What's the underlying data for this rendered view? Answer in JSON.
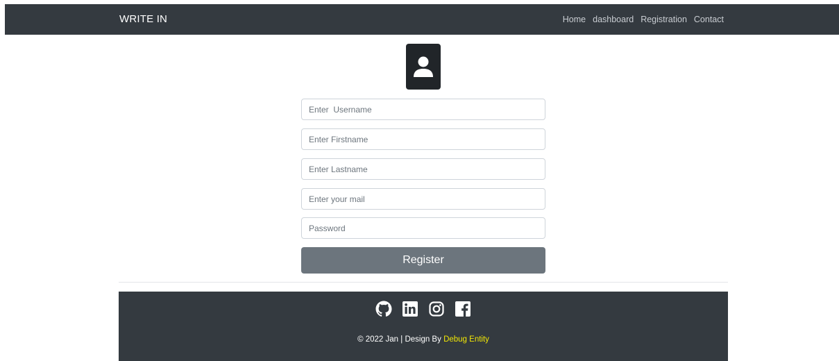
{
  "navbar": {
    "brand": "WRITE IN",
    "links": [
      "Home",
      "dashboard",
      "Registration",
      "Contact"
    ]
  },
  "form": {
    "username_placeholder": "Enter  Username",
    "firstname_placeholder": "Enter Firstname",
    "lastname_placeholder": "Enter Lastname",
    "email_placeholder": "Enter your mail",
    "password_placeholder": "Password",
    "register_label": "Register"
  },
  "footer": {
    "social_icons": [
      "github-icon",
      "linkedin-icon",
      "instagram-icon",
      "facebook-icon"
    ],
    "copyright_prefix": "© 2022 Jan | Design By ",
    "credit": "Debug Entity"
  },
  "colors": {
    "navbar_bg": "#343a40",
    "button_bg": "#6c757d",
    "credit_text": "#f1e705"
  }
}
